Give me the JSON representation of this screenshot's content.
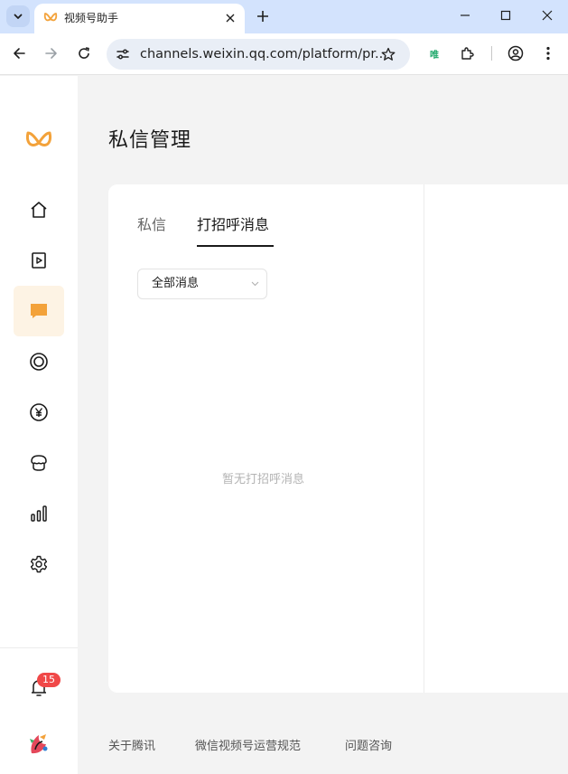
{
  "browser": {
    "tab_title": "视频号助手",
    "url": "channels.weixin.qq.com/platform/pr...",
    "extension_label": "唯",
    "icons": [
      "tab-search-icon",
      "channels-logo-icon",
      "close-icon",
      "plus-icon",
      "minimize-icon",
      "maximize-icon",
      "close-window-icon",
      "back-arrow-icon",
      "forward-arrow-icon",
      "reload-icon",
      "site-settings-icon",
      "bookmark-star-icon",
      "extension-icon",
      "puzzle-icon",
      "profile-icon",
      "more-vert-icon"
    ]
  },
  "sidebar": {
    "items": [
      {
        "name": "home",
        "icon": "home-icon"
      },
      {
        "name": "content",
        "icon": "video-play-icon"
      },
      {
        "name": "messages",
        "icon": "chat-bubble-icon",
        "active": true
      },
      {
        "name": "live",
        "icon": "live-ring-icon"
      },
      {
        "name": "income",
        "icon": "yen-icon"
      },
      {
        "name": "store",
        "icon": "store-icon"
      },
      {
        "name": "data",
        "icon": "bar-chart-icon"
      },
      {
        "name": "settings",
        "icon": "gear-icon"
      }
    ],
    "notification_count": "15"
  },
  "main": {
    "title": "私信管理",
    "tabs": [
      {
        "label": "私信",
        "active": false
      },
      {
        "label": "打招呼消息",
        "active": true
      }
    ],
    "filter": {
      "selected": "全部消息"
    },
    "empty_text": "暂无打招呼消息"
  },
  "footer": {
    "links": [
      "关于腾讯",
      "微信视频号运营规范",
      "问题咨询"
    ]
  },
  "colors": {
    "accent": "#f3a23a",
    "active_bg": "#fdf3e4",
    "badge": "#f04848",
    "tabstrip": "#d3e3fd"
  }
}
